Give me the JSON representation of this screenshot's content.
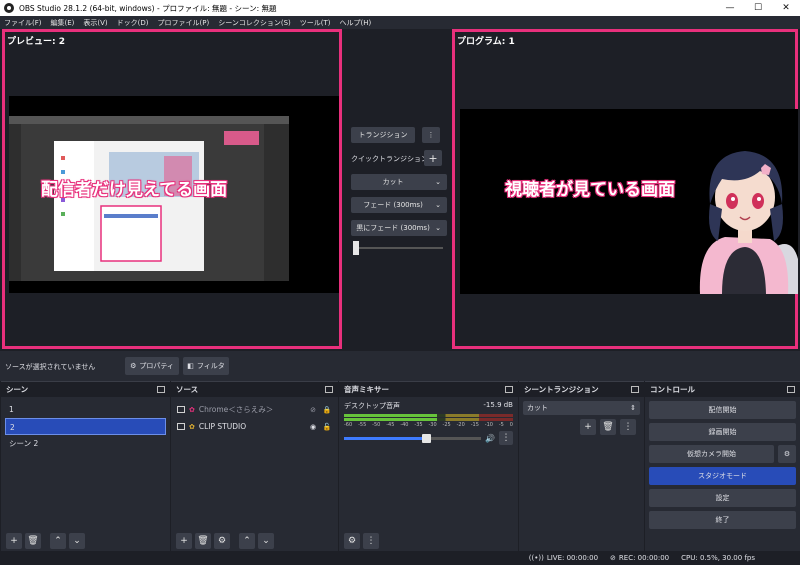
{
  "window": {
    "title": "OBS Studio 28.1.2 (64-bit, windows) - プロファイル: 無題 - シーン: 無題",
    "minimize": "—",
    "maximize": "☐",
    "close": "✕"
  },
  "menu": [
    "ファイル(F)",
    "編集(E)",
    "表示(V)",
    "ドック(D)",
    "プロファイル(P)",
    "シーンコレクション(S)",
    "ツール(T)",
    "ヘルプ(H)"
  ],
  "preview": {
    "header": "プレビュー: 2",
    "overlay": "配信者だけ見えてる画面"
  },
  "program": {
    "header": "プログラム: 1",
    "overlay": "視聴者が見ている画面"
  },
  "transition_panel": {
    "transition_button": "トランジション",
    "quick_label": "クイックトランジション",
    "options": [
      "カット",
      "フェード (300ms)",
      "黒にフェード (300ms)"
    ]
  },
  "sourcebar": {
    "label": "ソースが選択されていません",
    "properties_button": "プロパティ",
    "filters_button": "フィルタ"
  },
  "scenes": {
    "title": "シーン",
    "items": [
      "1",
      "2",
      "シーン 2"
    ],
    "selected_index": 1
  },
  "sources": {
    "title": "ソース",
    "items": [
      {
        "name": "Chrome＜さらえみ＞",
        "hidden": true
      },
      {
        "name": "CLIP STUDIO",
        "hidden": false
      }
    ]
  },
  "mixer": {
    "title": "音声ミキサー",
    "track_name": "デスクトップ音声",
    "level": "-15.9 dB",
    "ticks": [
      "-60",
      "-55",
      "-50",
      "-45",
      "-40",
      "-35",
      "-30",
      "-25",
      "-20",
      "-15",
      "-10",
      "-5",
      "0"
    ],
    "volume_fraction": 0.6
  },
  "scene_transitions": {
    "title": "シーントランジション",
    "selected": "カット"
  },
  "controls": {
    "title": "コントロール",
    "start_streaming": "配信開始",
    "start_recording": "録画開始",
    "start_virtualcam": "仮想カメラ開始",
    "studio_mode": "スタジオモード",
    "settings": "設定",
    "exit": "終了"
  },
  "status": {
    "live": "LIVE: 00:00:00",
    "rec": "REC: 00:00:00",
    "cpu": "CPU: 0.5%, 30.00 fps"
  },
  "colors": {
    "highlight": "#e8307c",
    "accent": "#284cb8"
  }
}
